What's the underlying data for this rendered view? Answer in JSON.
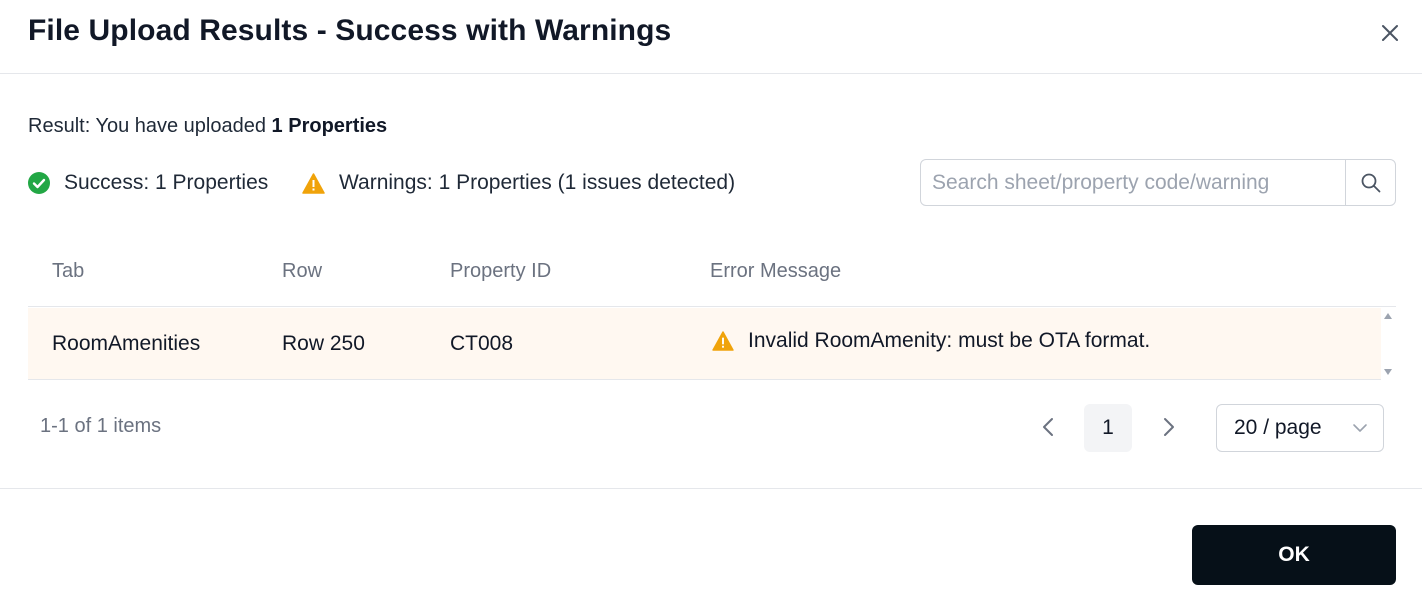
{
  "dialog": {
    "title": "File Upload Results - Success with Warnings"
  },
  "result": {
    "prefix": "Result: You have uploaded ",
    "count_text": "1 Properties"
  },
  "stats": {
    "success_text": "Success: 1 Properties",
    "warnings_text": "Warnings: 1 Properties (1 issues detected)",
    "success_color": "#22a745",
    "warning_color": "#f0a30a"
  },
  "search": {
    "placeholder": "Search sheet/property code/warning",
    "value": ""
  },
  "table": {
    "columns": [
      "Tab",
      "Row",
      "Property ID",
      "Error Message"
    ],
    "rows": [
      {
        "tab": "RoomAmenities",
        "row": "Row 250",
        "property_id": "CT008",
        "error_message": "Invalid RoomAmenity: must be OTA format.",
        "severity_icon": "warning-icon"
      }
    ]
  },
  "pagination": {
    "total_text": "1-1 of 1 items",
    "current_page": "1",
    "page_size": "20 / page"
  },
  "footer": {
    "ok_label": "OK"
  }
}
